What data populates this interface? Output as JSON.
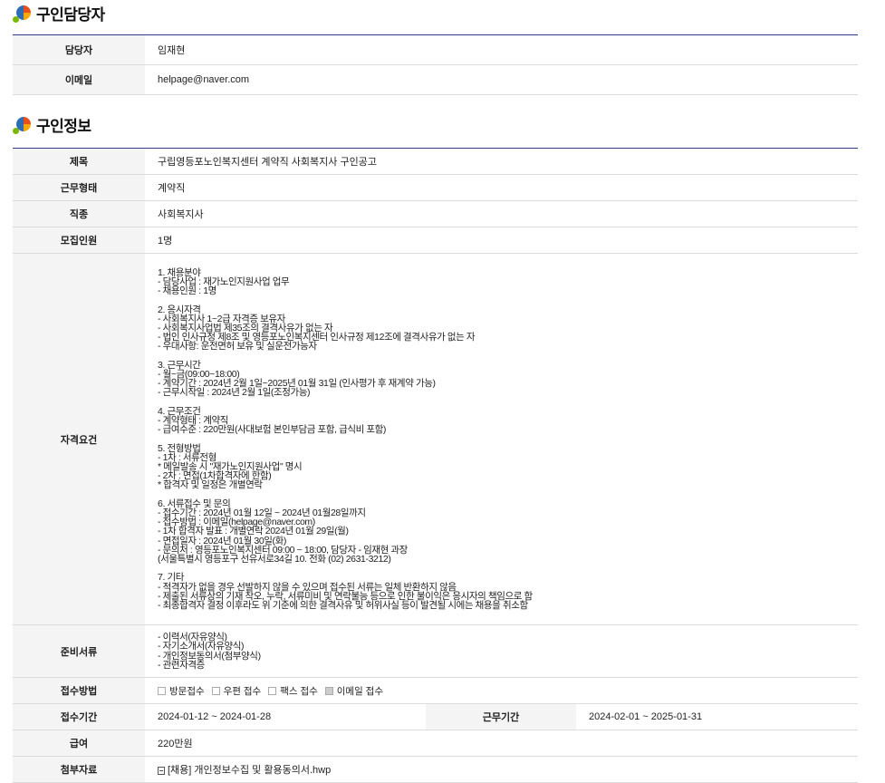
{
  "contact": {
    "title": "구인담당자",
    "rows": [
      {
        "label": "담당자",
        "value": "임재현"
      },
      {
        "label": "이메일",
        "value": "helpage@naver.com"
      }
    ]
  },
  "job": {
    "title": "구인정보",
    "subject_label": "제목",
    "subject": "구립영등포노인복지센터 계약직 사회복지사 구인공고",
    "type_label": "근무형태",
    "type": "계약직",
    "occupation_label": "직종",
    "occupation": "사회복지사",
    "headcount_label": "모집인원",
    "headcount": "1명",
    "qual_label": "자격요건",
    "qualifications": "1. 채용분야\n- 담당사업 : 재가노인지원사업 업무\n- 채용인원 : 1명\n\n2. 응시자격\n- 사회복지사 1~2급 자격증 보유자\n- 사회복지사업법 제35조의 결격사유가 없는 자\n- 법인 인사규정 제8조 및 영등포노인복지센터 인사규정 제12조에 결격사유가 없는 자\n- 우대사항: 운전면허 보유 및 실운전가능자\n\n3. 근무시간\n- 월~금(09:00~18:00)\n- 계약기간 : 2024년 2월 1일~2025년 01월 31일 (인사평가 후 재계약 가능)\n- 근무시작일 : 2024년 2월 1일(조정가능)\n\n4. 근무조건\n- 계약형태 : 계약직\n- 급여수준 : 220만원(사대보험 본인부담금 포함, 급식비 포함)\n\n5. 전형방법\n- 1차 : 서류전형\n* 메일발송 시 \"재가노인지원사업\" 명시\n- 2차 : 면접(1차합격자에 한함)\n* 합격자 및 일정은 개별연락\n\n6. 서류접수 및 문의\n- 접수기간 : 2024년 01월 12일 ~ 2024년 01월28일까지\n- 접수방법 : 이메일(helpage@naver.com)\n- 1차 합격자 발표 : 개별연락 2024년 01월 29일(월)\n- 면접일자 : 2024년 01월 30일(화)\n- 문의처 : 영등포노인복지센터 09:00 ~ 18:00, 담당자 - 임재현 과장\n(서울특별시 영등포구 선유서로34길 10. 전화 (02) 2631-3212)\n\n7. 기타\n- 적격자가 없을 경우 선발하지 않을 수 있으며 접수된 서류는 일체 반환하지 않음\n- 제출된 서류상의 기재 착오, 누락, 서류미비 및 연락불능 등으로 인한 불이익은 응시자의 책임으로 함\n- 최종합격자 결정 이후라도 위 기준에 의한 결격사유 및 허위사실 등이 발견될 시에는 채용을 취소함",
    "docs_label": "준비서류",
    "docs": "- 이력서(자유양식)\n- 자기소개서(자유양식)\n- 개인정보동의서(첨부양식)\n- 관련자격증",
    "method_label": "접수방법",
    "methods": [
      {
        "label": "방문접수",
        "checked": false
      },
      {
        "label": "우편 접수",
        "checked": false
      },
      {
        "label": "팩스 접수",
        "checked": false
      },
      {
        "label": "이메일 접수",
        "checked": true
      }
    ],
    "apply_period_label": "접수기간",
    "apply_period": "2024-01-12 ~ 2024-01-28",
    "work_period_label": "근무기간",
    "work_period": "2024-02-01 ~ 2025-01-31",
    "salary_label": "급여",
    "salary": "220만원",
    "attach_label": "첨부자료",
    "attachment": "[채용] 개인정보수집 및 활용동의서.hwp"
  }
}
